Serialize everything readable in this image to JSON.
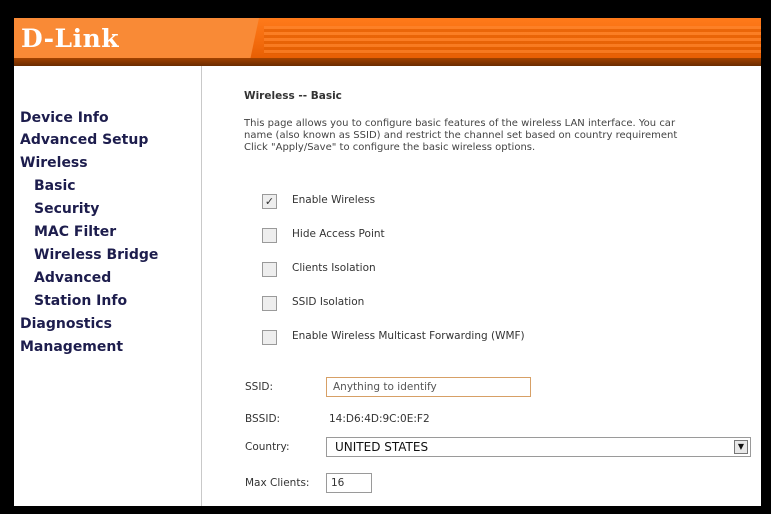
{
  "brand": {
    "logo_text": "D-Link",
    "accent_color": "#f26a0c"
  },
  "sidebar": {
    "items": [
      {
        "label": "Device Info"
      },
      {
        "label": "Advanced Setup"
      },
      {
        "label": "Wireless"
      },
      {
        "label": "Basic"
      },
      {
        "label": "Security"
      },
      {
        "label": "MAC Filter"
      },
      {
        "label": "Wireless Bridge"
      },
      {
        "label": "Advanced"
      },
      {
        "label": "Station Info"
      },
      {
        "label": "Diagnostics"
      },
      {
        "label": "Management"
      }
    ]
  },
  "main": {
    "title": "Wireless -- Basic",
    "description": [
      "This page allows you to configure basic features of the wireless LAN interface. You car",
      "name (also known as SSID) and restrict the channel set based on country requirement",
      "Click \"Apply/Save\" to configure the basic wireless options."
    ],
    "checkboxes": [
      {
        "label": "Enable Wireless",
        "checked": true,
        "mark": "✓"
      },
      {
        "label": "Hide Access Point",
        "checked": false,
        "mark": ""
      },
      {
        "label": "Clients Isolation",
        "checked": false,
        "mark": ""
      },
      {
        "label": "SSID Isolation",
        "checked": false,
        "mark": ""
      },
      {
        "label": "Enable Wireless Multicast Forwarding (WMF)",
        "checked": false,
        "mark": ""
      }
    ],
    "ssid": {
      "label": "SSID:",
      "value": "Anything to identify"
    },
    "bssid": {
      "label": "BSSID:",
      "value": "14:D6:4D:9C:0E:F2"
    },
    "country": {
      "label": "Country:",
      "value": "UNITED STATES"
    },
    "max_clients": {
      "label": "Max Clients:",
      "value": "16"
    }
  }
}
